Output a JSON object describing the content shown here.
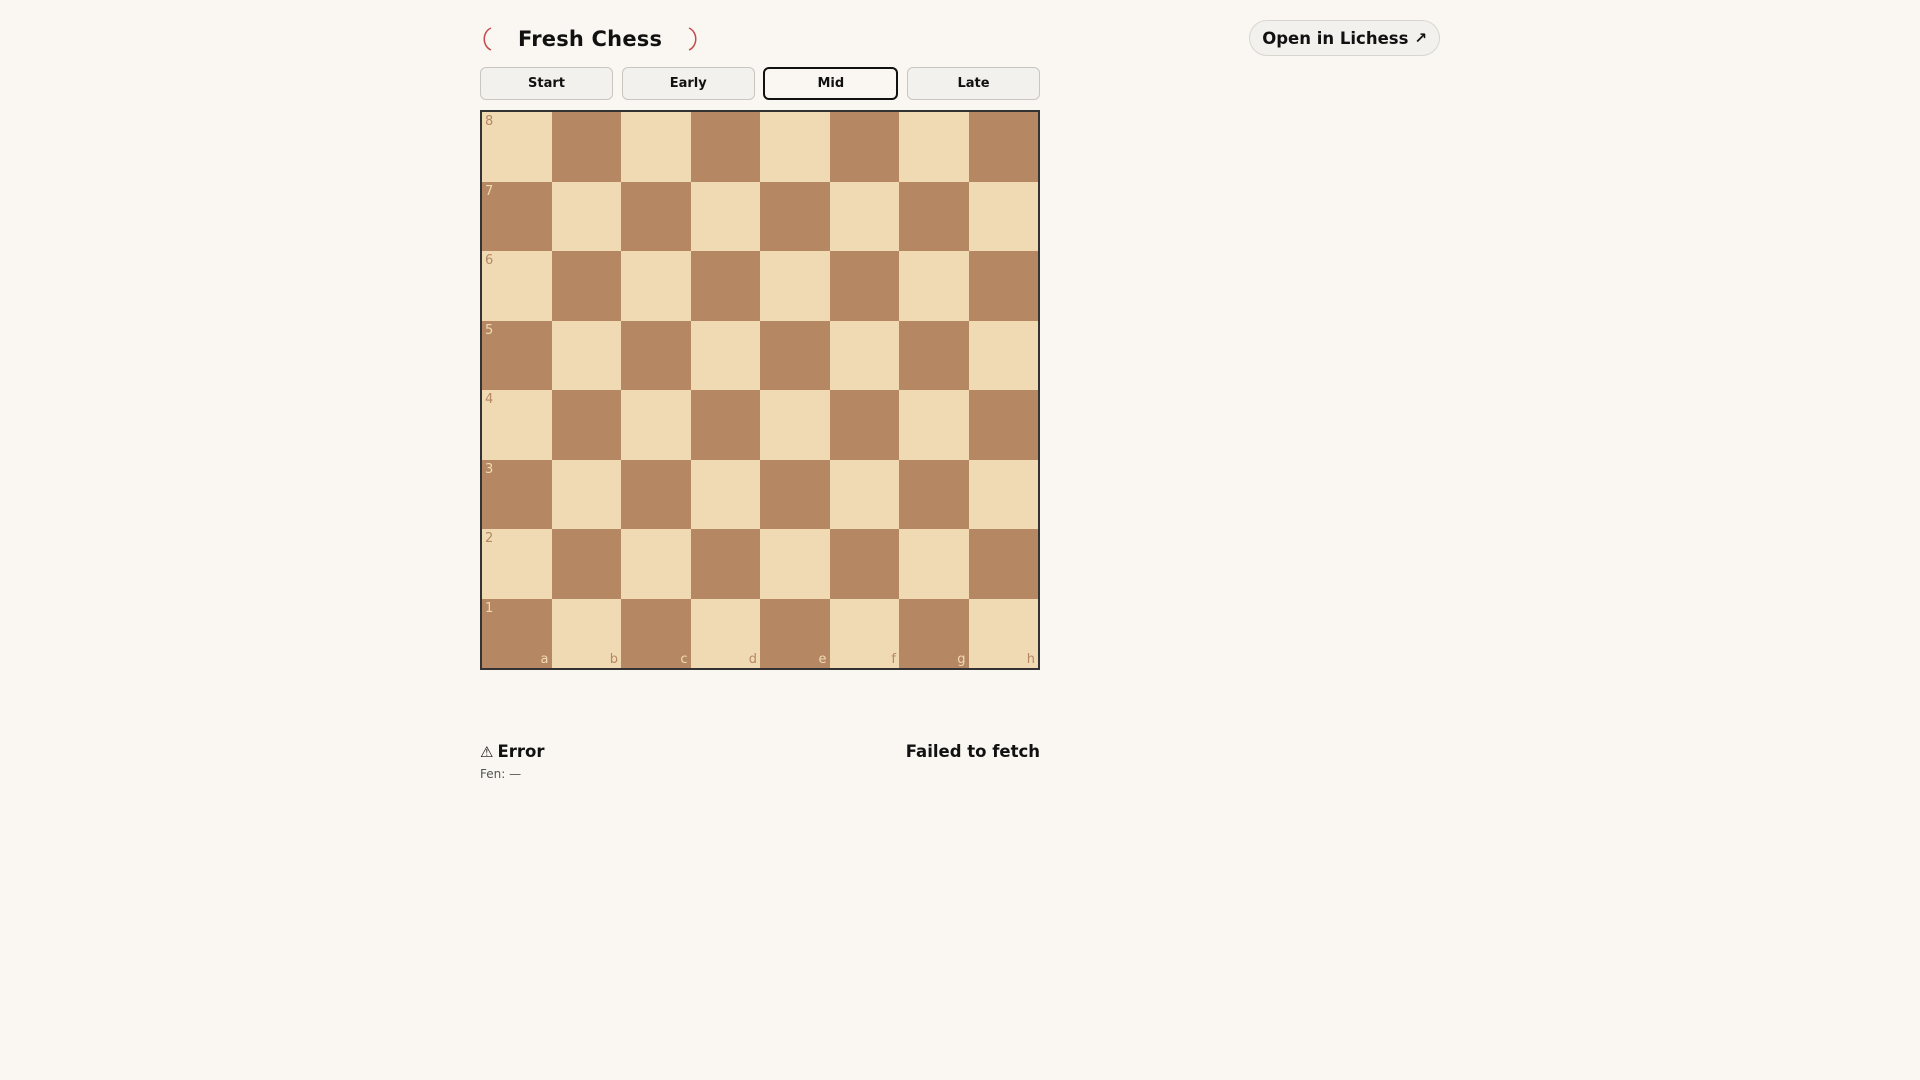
{
  "header": {
    "title": "Fresh Chess",
    "open_button_label": "Open in Lichess",
    "open_button_icon": "external-arrow-icon",
    "open_button_glyph": "↗"
  },
  "tabs": [
    {
      "label": "Start",
      "active": false
    },
    {
      "label": "Early",
      "active": false
    },
    {
      "label": "Mid",
      "active": true
    },
    {
      "label": "Late",
      "active": false
    }
  ],
  "board": {
    "ranks": [
      "8",
      "7",
      "6",
      "5",
      "4",
      "3",
      "2",
      "1"
    ],
    "files": [
      "a",
      "b",
      "c",
      "d",
      "e",
      "f",
      "g",
      "h"
    ],
    "light_color": "#f0dab4",
    "dark_color": "#b58863"
  },
  "status": {
    "icon": "warning-icon",
    "icon_glyph": "⚠",
    "label": "Error",
    "message": "Failed to fetch",
    "fen_label": "Fen: —"
  },
  "colors": {
    "background": "#faf7f2",
    "accent": "#c24b4b"
  }
}
